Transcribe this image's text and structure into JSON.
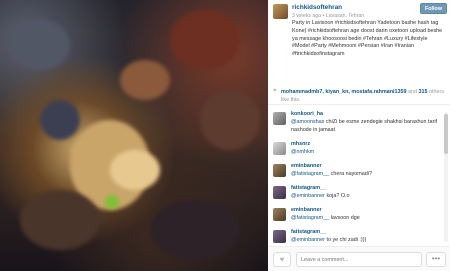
{
  "post": {
    "username": "richkidsoftehran",
    "time_ago": "3 weeks ago",
    "location_icon": "location-pin-icon",
    "location": "Lavasan, Tehran",
    "follow_label": "Follow",
    "caption": "Party in Lavisoon #richkidsoftehran Yadetoon bashe hash tag Kone) #richkidsoftehran age doost darin oxetoon upload beshe ya message khoosoosi bedin #Tehran #Luxury #Lifestyle #Model #Party #Mehmooni #Persian #Iran #Iranian #ftrichkidsofinstagram"
  },
  "likes": {
    "icon": "heart-icon",
    "names": "mohammadmb7, kiyan_kn, mostafa.rahmani1359",
    "connector": "and",
    "count": "315",
    "suffix": "others like this."
  },
  "comments": [
    {
      "user": "konkoori_ha",
      "mention": "@amoonshas",
      "text": " chiZi be esme zendegie shakhsi baraxhun tarif nashode in jamaat"
    },
    {
      "user": "mhsnrz",
      "mention": "@nmhkm",
      "text": ""
    },
    {
      "user": "eminbanner",
      "mention": "@fatistagram__",
      "text": " chera nayomadi?"
    },
    {
      "user": "fatistagram__",
      "mention": "@eminbanner",
      "text": " koja? O.o"
    },
    {
      "user": "eminbanner",
      "mention": "@fatistagram__",
      "text": " lavsoon dge"
    },
    {
      "user": "fatistagram__",
      "mention": "@eminbanner",
      "text": " to ye chi zadi :)))"
    }
  ],
  "footer": {
    "like_icon": "heart-icon",
    "comment_placeholder": "Leave a comment...",
    "more_icon": "ellipsis-icon",
    "more_label": "•••"
  }
}
